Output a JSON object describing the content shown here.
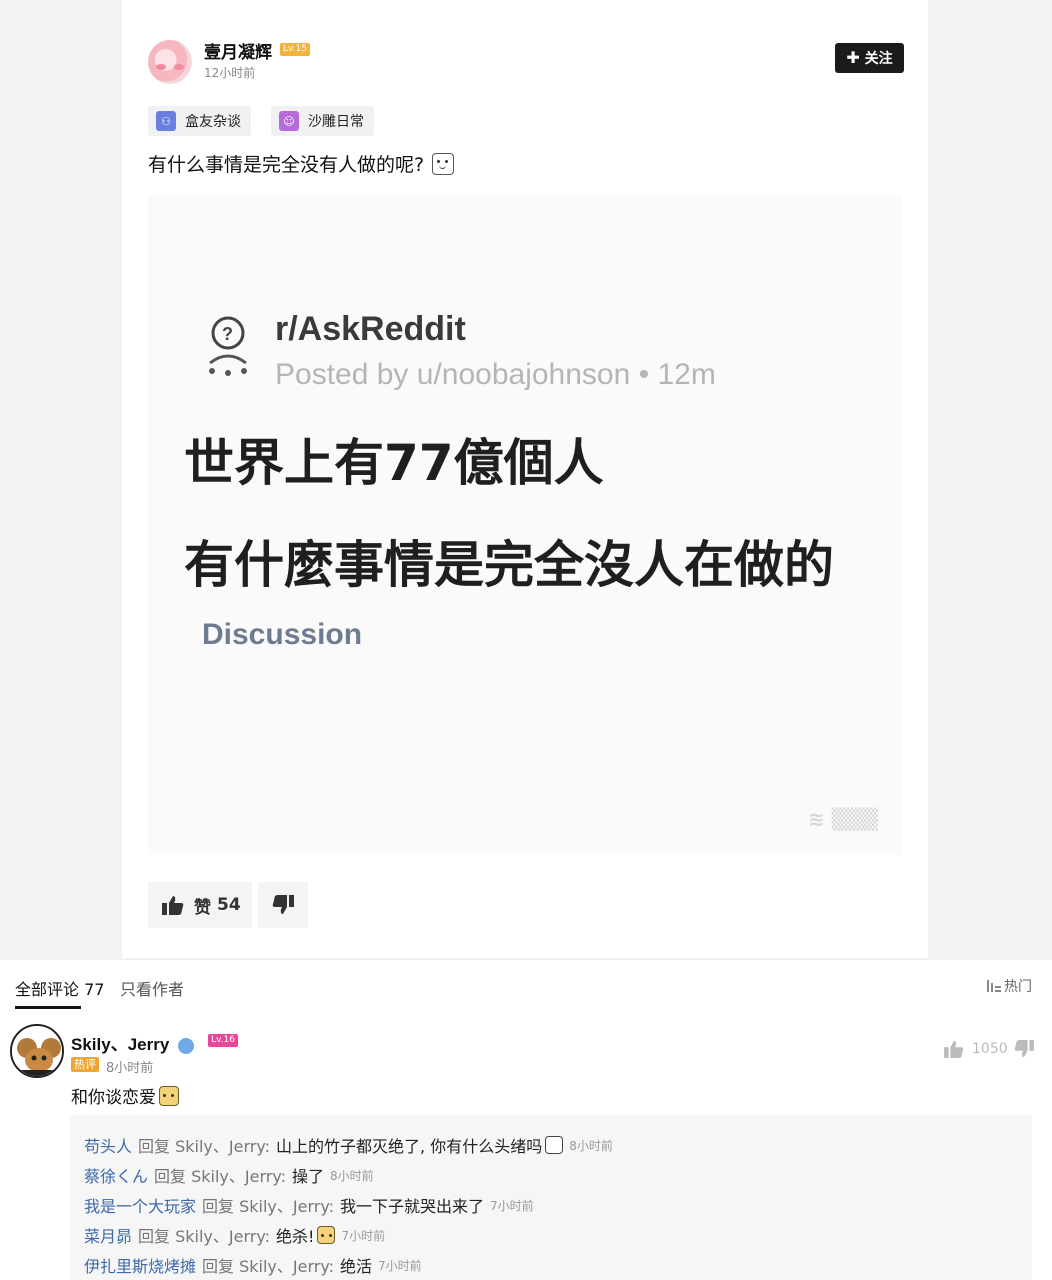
{
  "post": {
    "author": "壹月凝辉",
    "level": "Lv.15",
    "time": "12小时前",
    "follow_label": "关注",
    "tags": [
      "盒友杂谈",
      "沙雕日常"
    ],
    "title": "有什么事情是完全没有人做的呢?",
    "image": {
      "subreddit": "r/AskReddit",
      "posted_by": "Posted by u/noobajohnson • 12m",
      "line1": "世界上有77億個人",
      "line2": "有什麼事情是完全沒人在做的",
      "flair": "Discussion"
    },
    "like_label": "赞",
    "like_count": "54"
  },
  "comments": {
    "tab_all": "全部评论 77",
    "tab_author": "只看作者",
    "sort_label": "热门",
    "top_comment": {
      "author": "Skily、Jerry",
      "level": "Lv.16",
      "hot_badge": "热评",
      "time": "8小时前",
      "text": "和你谈恋爱",
      "likes": "1050"
    },
    "replies": [
      {
        "name": "苟头人",
        "verb": "回复 Skily、Jerry:",
        "text": "山上的竹子都灭绝了, 你有什么头绪吗",
        "time": "8小时前"
      },
      {
        "name": "蔡徐くん",
        "verb": "回复 Skily、Jerry:",
        "text": "操了",
        "time": "8小时前"
      },
      {
        "name": "我是一个大玩家",
        "verb": "回复 Skily、Jerry:",
        "text": "我一下子就哭出来了",
        "time": "7小时前"
      },
      {
        "name": "菜月昴",
        "verb": "回复 Skily、Jerry:",
        "text": "绝杀!",
        "time": "7小时前"
      },
      {
        "name": "伊扎里斯烧烤摊",
        "verb": "回复 Skily、Jerry:",
        "text": "绝活",
        "time": "7小时前"
      }
    ]
  },
  "colors": {
    "follow_bg": "#1b1b1b",
    "level_badge_author": "#f3b33d",
    "level_badge_commenter": "#e8479a",
    "hot_badge": "#f0a531",
    "reply_name": "#3d6aa9"
  },
  "icons": [
    "plus-icon",
    "thumbs-up-icon",
    "thumbs-down-icon",
    "sort-icon",
    "verified-icon",
    "face-emoji-icon",
    "cat-emoji-icon",
    "panda-emoji-icon",
    "reddit-logo-icon"
  ]
}
